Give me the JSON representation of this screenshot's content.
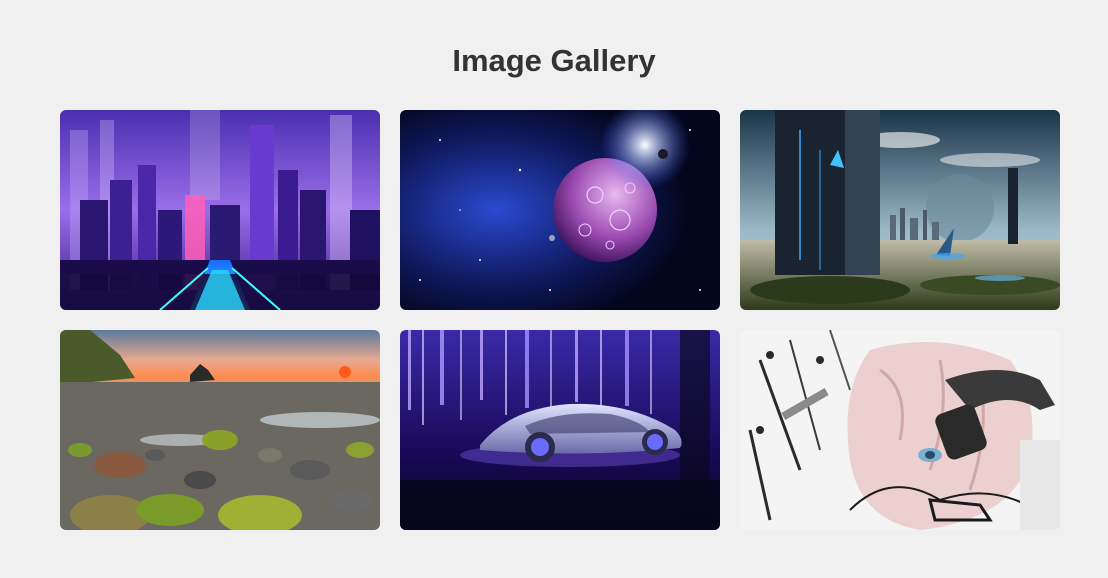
{
  "page": {
    "title": "Image Gallery",
    "background": "#f0f0f0"
  },
  "gallery": {
    "images": [
      {
        "subject": "neon-cyberpunk-city",
        "palette": [
          "#2a1a6e",
          "#8a5cf0",
          "#1fd3ff",
          "#ff4fa8"
        ]
      },
      {
        "subject": "purple-planet-in-space",
        "palette": [
          "#050a2a",
          "#1a2a8a",
          "#c58adf",
          "#ffffff"
        ]
      },
      {
        "subject": "futuristic-city-wasteland-with-monolith",
        "palette": [
          "#1a3a4a",
          "#c9c9b8",
          "#3fa8ff",
          "#2e3a1a"
        ]
      },
      {
        "subject": "rocky-beach-at-sunset",
        "palette": [
          "#6a8aa8",
          "#ff7a3a",
          "#7a9a2a",
          "#6a6a6a"
        ]
      },
      {
        "subject": "concept-car-purple-forest",
        "palette": [
          "#1a0a4a",
          "#8a6aff",
          "#c0c8ff",
          "#05051a"
        ]
      },
      {
        "subject": "anime-girl-with-headphones",
        "palette": [
          "#ffffff",
          "#e8c8c8",
          "#2a2a2a",
          "#7ab0d0"
        ]
      }
    ]
  }
}
